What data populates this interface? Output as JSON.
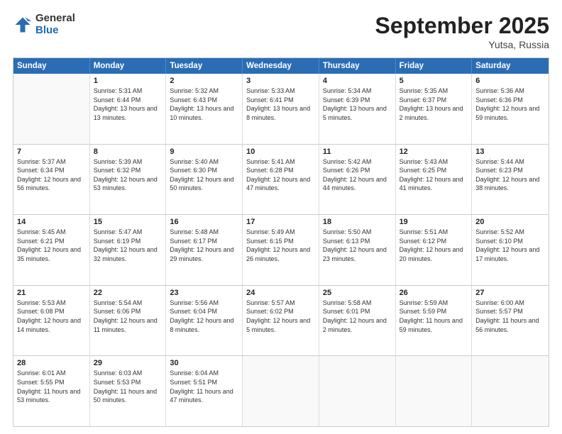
{
  "header": {
    "logo": {
      "general": "General",
      "blue": "Blue"
    },
    "month": "September 2025",
    "location": "Yutsa, Russia"
  },
  "weekdays": [
    "Sunday",
    "Monday",
    "Tuesday",
    "Wednesday",
    "Thursday",
    "Friday",
    "Saturday"
  ],
  "weeks": [
    [
      {
        "day": "",
        "empty": true
      },
      {
        "day": "1",
        "sunrise": "Sunrise: 5:31 AM",
        "sunset": "Sunset: 6:44 PM",
        "daylight": "Daylight: 13 hours and 13 minutes."
      },
      {
        "day": "2",
        "sunrise": "Sunrise: 5:32 AM",
        "sunset": "Sunset: 6:43 PM",
        "daylight": "Daylight: 13 hours and 10 minutes."
      },
      {
        "day": "3",
        "sunrise": "Sunrise: 5:33 AM",
        "sunset": "Sunset: 6:41 PM",
        "daylight": "Daylight: 13 hours and 8 minutes."
      },
      {
        "day": "4",
        "sunrise": "Sunrise: 5:34 AM",
        "sunset": "Sunset: 6:39 PM",
        "daylight": "Daylight: 13 hours and 5 minutes."
      },
      {
        "day": "5",
        "sunrise": "Sunrise: 5:35 AM",
        "sunset": "Sunset: 6:37 PM",
        "daylight": "Daylight: 13 hours and 2 minutes."
      },
      {
        "day": "6",
        "sunrise": "Sunrise: 5:36 AM",
        "sunset": "Sunset: 6:36 PM",
        "daylight": "Daylight: 12 hours and 59 minutes."
      }
    ],
    [
      {
        "day": "7",
        "sunrise": "Sunrise: 5:37 AM",
        "sunset": "Sunset: 6:34 PM",
        "daylight": "Daylight: 12 hours and 56 minutes."
      },
      {
        "day": "8",
        "sunrise": "Sunrise: 5:39 AM",
        "sunset": "Sunset: 6:32 PM",
        "daylight": "Daylight: 12 hours and 53 minutes."
      },
      {
        "day": "9",
        "sunrise": "Sunrise: 5:40 AM",
        "sunset": "Sunset: 6:30 PM",
        "daylight": "Daylight: 12 hours and 50 minutes."
      },
      {
        "day": "10",
        "sunrise": "Sunrise: 5:41 AM",
        "sunset": "Sunset: 6:28 PM",
        "daylight": "Daylight: 12 hours and 47 minutes."
      },
      {
        "day": "11",
        "sunrise": "Sunrise: 5:42 AM",
        "sunset": "Sunset: 6:26 PM",
        "daylight": "Daylight: 12 hours and 44 minutes."
      },
      {
        "day": "12",
        "sunrise": "Sunrise: 5:43 AM",
        "sunset": "Sunset: 6:25 PM",
        "daylight": "Daylight: 12 hours and 41 minutes."
      },
      {
        "day": "13",
        "sunrise": "Sunrise: 5:44 AM",
        "sunset": "Sunset: 6:23 PM",
        "daylight": "Daylight: 12 hours and 38 minutes."
      }
    ],
    [
      {
        "day": "14",
        "sunrise": "Sunrise: 5:45 AM",
        "sunset": "Sunset: 6:21 PM",
        "daylight": "Daylight: 12 hours and 35 minutes."
      },
      {
        "day": "15",
        "sunrise": "Sunrise: 5:47 AM",
        "sunset": "Sunset: 6:19 PM",
        "daylight": "Daylight: 12 hours and 32 minutes."
      },
      {
        "day": "16",
        "sunrise": "Sunrise: 5:48 AM",
        "sunset": "Sunset: 6:17 PM",
        "daylight": "Daylight: 12 hours and 29 minutes."
      },
      {
        "day": "17",
        "sunrise": "Sunrise: 5:49 AM",
        "sunset": "Sunset: 6:15 PM",
        "daylight": "Daylight: 12 hours and 26 minutes."
      },
      {
        "day": "18",
        "sunrise": "Sunrise: 5:50 AM",
        "sunset": "Sunset: 6:13 PM",
        "daylight": "Daylight: 12 hours and 23 minutes."
      },
      {
        "day": "19",
        "sunrise": "Sunrise: 5:51 AM",
        "sunset": "Sunset: 6:12 PM",
        "daylight": "Daylight: 12 hours and 20 minutes."
      },
      {
        "day": "20",
        "sunrise": "Sunrise: 5:52 AM",
        "sunset": "Sunset: 6:10 PM",
        "daylight": "Daylight: 12 hours and 17 minutes."
      }
    ],
    [
      {
        "day": "21",
        "sunrise": "Sunrise: 5:53 AM",
        "sunset": "Sunset: 6:08 PM",
        "daylight": "Daylight: 12 hours and 14 minutes."
      },
      {
        "day": "22",
        "sunrise": "Sunrise: 5:54 AM",
        "sunset": "Sunset: 6:06 PM",
        "daylight": "Daylight: 12 hours and 11 minutes."
      },
      {
        "day": "23",
        "sunrise": "Sunrise: 5:56 AM",
        "sunset": "Sunset: 6:04 PM",
        "daylight": "Daylight: 12 hours and 8 minutes."
      },
      {
        "day": "24",
        "sunrise": "Sunrise: 5:57 AM",
        "sunset": "Sunset: 6:02 PM",
        "daylight": "Daylight: 12 hours and 5 minutes."
      },
      {
        "day": "25",
        "sunrise": "Sunrise: 5:58 AM",
        "sunset": "Sunset: 6:01 PM",
        "daylight": "Daylight: 12 hours and 2 minutes."
      },
      {
        "day": "26",
        "sunrise": "Sunrise: 5:59 AM",
        "sunset": "Sunset: 5:59 PM",
        "daylight": "Daylight: 11 hours and 59 minutes."
      },
      {
        "day": "27",
        "sunrise": "Sunrise: 6:00 AM",
        "sunset": "Sunset: 5:57 PM",
        "daylight": "Daylight: 11 hours and 56 minutes."
      }
    ],
    [
      {
        "day": "28",
        "sunrise": "Sunrise: 6:01 AM",
        "sunset": "Sunset: 5:55 PM",
        "daylight": "Daylight: 11 hours and 53 minutes."
      },
      {
        "day": "29",
        "sunrise": "Sunrise: 6:03 AM",
        "sunset": "Sunset: 5:53 PM",
        "daylight": "Daylight: 11 hours and 50 minutes."
      },
      {
        "day": "30",
        "sunrise": "Sunrise: 6:04 AM",
        "sunset": "Sunset: 5:51 PM",
        "daylight": "Daylight: 11 hours and 47 minutes."
      },
      {
        "day": "",
        "empty": true
      },
      {
        "day": "",
        "empty": true
      },
      {
        "day": "",
        "empty": true
      },
      {
        "day": "",
        "empty": true
      }
    ]
  ]
}
